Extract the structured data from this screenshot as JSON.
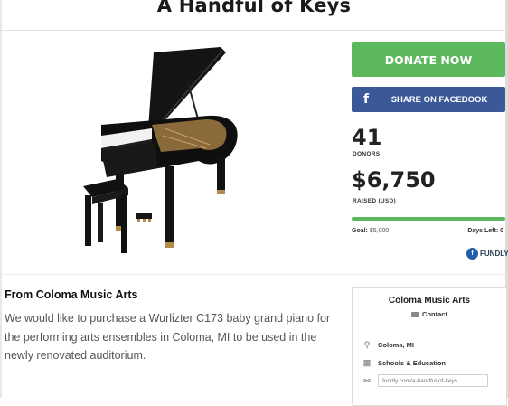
{
  "page": {
    "title": "A Handful of Keys"
  },
  "campaign": {
    "donate_label": "DONATE NOW",
    "facebook_icon": "f",
    "facebook_label": "SHARE ON FACEBOOK",
    "donors_count": "41",
    "donors_label": "DONORS",
    "raised_amount": "$6,750",
    "raised_label": "RAISED (USD)",
    "progress_fraction": 1.0,
    "goal_label": "Goal:",
    "goal_value": "$5,000",
    "days_left_label": "Days Left: 0",
    "brand": "FUNDLY",
    "brand_logo_letter": "f"
  },
  "about": {
    "heading": "From Coloma Music Arts",
    "description": "We would like to purchase a Wurlizter C173 baby grand piano for the performing arts ensembles in Coloma, MI to be used in the newly renovated auditorium."
  },
  "organizer_card": {
    "name": "Coloma Music Arts",
    "contact_label": "Contact",
    "location": "Coloma, MI",
    "category": "Schools & Education",
    "url": "fundly.com/a-handful-of-keys"
  },
  "colors": {
    "donate": "#5cb85c",
    "facebook": "#3b5998",
    "progress": "#5cb85c"
  },
  "icons": [
    "piano-image",
    "facebook-icon",
    "fundly-logo",
    "envelope-icon",
    "map-pin-icon",
    "school-icon",
    "link-icon"
  ]
}
